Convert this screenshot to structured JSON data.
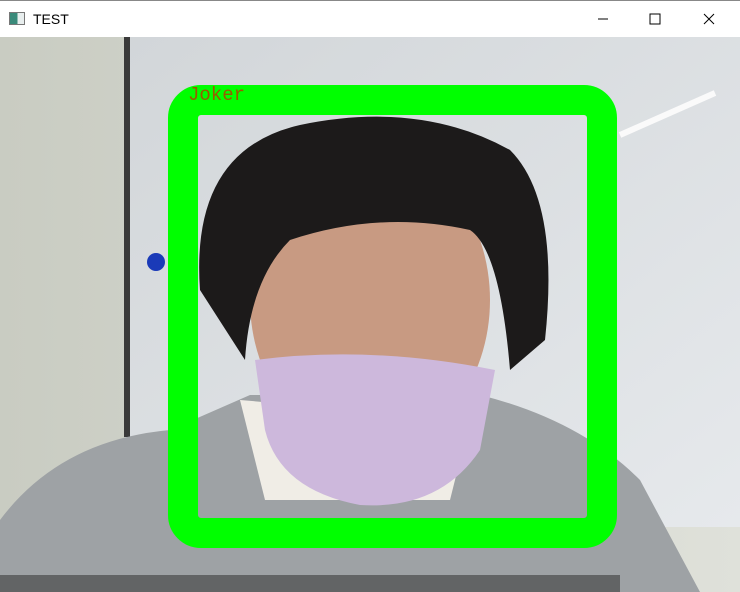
{
  "window": {
    "title": "TEST",
    "icons": [
      "app-icon",
      "minimize-icon",
      "maximize-icon",
      "close-icon"
    ]
  },
  "detection": {
    "label": "Joker",
    "box_color": "#00ff00",
    "label_color": "#9a5a00"
  }
}
